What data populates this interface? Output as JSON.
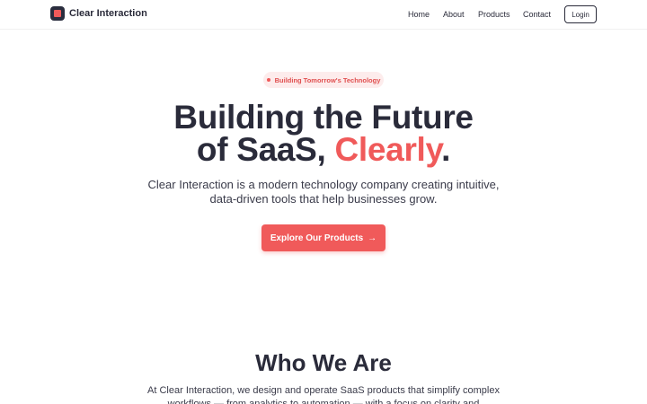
{
  "brand": {
    "name": "Clear Interaction",
    "logo_icon": "square-logo-icon"
  },
  "nav": {
    "home": "Home",
    "about": "About",
    "products": "Products",
    "contact": "Contact",
    "login": "Login"
  },
  "hero": {
    "badge": "Building Tomorrow's Technology",
    "title_line1": "Building the Future",
    "title_line2_prefix": "of SaaS, ",
    "title_accent": "Clearly",
    "title_suffix": ".",
    "subtitle": "Clear Interaction is a modern technology company creating intuitive, data-driven tools that help businesses grow.",
    "cta": "Explore Our Products",
    "cta_icon": "arrow-right-icon"
  },
  "about": {
    "title": "Who We Are",
    "text": "At Clear Interaction, we design and operate SaaS products that simplify complex workflows — from analytics to automation — with a focus on clarity and"
  },
  "colors": {
    "accent": "#f05a5a",
    "dark": "#2a2b3a",
    "badge_bg": "#fdecec"
  }
}
